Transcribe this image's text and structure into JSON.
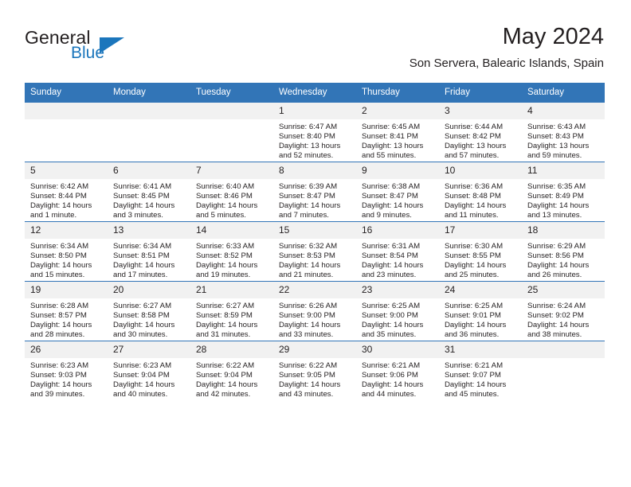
{
  "brand": {
    "name_primary": "General",
    "name_secondary": "Blue",
    "triangle_color": "#1b76bc"
  },
  "header": {
    "month_title": "May 2024",
    "location": "Son Servera, Balearic Islands, Spain"
  },
  "theme": {
    "header_blue": "#3275b7",
    "daynum_gray": "#f1f1f1",
    "text_color": "#231f20"
  },
  "calendar": {
    "weekday_headers": [
      "Sunday",
      "Monday",
      "Tuesday",
      "Wednesday",
      "Thursday",
      "Friday",
      "Saturday"
    ],
    "weeks": [
      [
        {
          "day": "",
          "empty": true
        },
        {
          "day": "",
          "empty": true
        },
        {
          "day": "",
          "empty": true
        },
        {
          "day": "1",
          "sunrise": "Sunrise: 6:47 AM",
          "sunset": "Sunset: 8:40 PM",
          "daylight_line1": "Daylight: 13 hours",
          "daylight_line2": "and 52 minutes."
        },
        {
          "day": "2",
          "sunrise": "Sunrise: 6:45 AM",
          "sunset": "Sunset: 8:41 PM",
          "daylight_line1": "Daylight: 13 hours",
          "daylight_line2": "and 55 minutes."
        },
        {
          "day": "3",
          "sunrise": "Sunrise: 6:44 AM",
          "sunset": "Sunset: 8:42 PM",
          "daylight_line1": "Daylight: 13 hours",
          "daylight_line2": "and 57 minutes."
        },
        {
          "day": "4",
          "sunrise": "Sunrise: 6:43 AM",
          "sunset": "Sunset: 8:43 PM",
          "daylight_line1": "Daylight: 13 hours",
          "daylight_line2": "and 59 minutes."
        }
      ],
      [
        {
          "day": "5",
          "sunrise": "Sunrise: 6:42 AM",
          "sunset": "Sunset: 8:44 PM",
          "daylight_line1": "Daylight: 14 hours",
          "daylight_line2": "and 1 minute."
        },
        {
          "day": "6",
          "sunrise": "Sunrise: 6:41 AM",
          "sunset": "Sunset: 8:45 PM",
          "daylight_line1": "Daylight: 14 hours",
          "daylight_line2": "and 3 minutes."
        },
        {
          "day": "7",
          "sunrise": "Sunrise: 6:40 AM",
          "sunset": "Sunset: 8:46 PM",
          "daylight_line1": "Daylight: 14 hours",
          "daylight_line2": "and 5 minutes."
        },
        {
          "day": "8",
          "sunrise": "Sunrise: 6:39 AM",
          "sunset": "Sunset: 8:47 PM",
          "daylight_line1": "Daylight: 14 hours",
          "daylight_line2": "and 7 minutes."
        },
        {
          "day": "9",
          "sunrise": "Sunrise: 6:38 AM",
          "sunset": "Sunset: 8:47 PM",
          "daylight_line1": "Daylight: 14 hours",
          "daylight_line2": "and 9 minutes."
        },
        {
          "day": "10",
          "sunrise": "Sunrise: 6:36 AM",
          "sunset": "Sunset: 8:48 PM",
          "daylight_line1": "Daylight: 14 hours",
          "daylight_line2": "and 11 minutes."
        },
        {
          "day": "11",
          "sunrise": "Sunrise: 6:35 AM",
          "sunset": "Sunset: 8:49 PM",
          "daylight_line1": "Daylight: 14 hours",
          "daylight_line2": "and 13 minutes."
        }
      ],
      [
        {
          "day": "12",
          "sunrise": "Sunrise: 6:34 AM",
          "sunset": "Sunset: 8:50 PM",
          "daylight_line1": "Daylight: 14 hours",
          "daylight_line2": "and 15 minutes."
        },
        {
          "day": "13",
          "sunrise": "Sunrise: 6:34 AM",
          "sunset": "Sunset: 8:51 PM",
          "daylight_line1": "Daylight: 14 hours",
          "daylight_line2": "and 17 minutes."
        },
        {
          "day": "14",
          "sunrise": "Sunrise: 6:33 AM",
          "sunset": "Sunset: 8:52 PM",
          "daylight_line1": "Daylight: 14 hours",
          "daylight_line2": "and 19 minutes."
        },
        {
          "day": "15",
          "sunrise": "Sunrise: 6:32 AM",
          "sunset": "Sunset: 8:53 PM",
          "daylight_line1": "Daylight: 14 hours",
          "daylight_line2": "and 21 minutes."
        },
        {
          "day": "16",
          "sunrise": "Sunrise: 6:31 AM",
          "sunset": "Sunset: 8:54 PM",
          "daylight_line1": "Daylight: 14 hours",
          "daylight_line2": "and 23 minutes."
        },
        {
          "day": "17",
          "sunrise": "Sunrise: 6:30 AM",
          "sunset": "Sunset: 8:55 PM",
          "daylight_line1": "Daylight: 14 hours",
          "daylight_line2": "and 25 minutes."
        },
        {
          "day": "18",
          "sunrise": "Sunrise: 6:29 AM",
          "sunset": "Sunset: 8:56 PM",
          "daylight_line1": "Daylight: 14 hours",
          "daylight_line2": "and 26 minutes."
        }
      ],
      [
        {
          "day": "19",
          "sunrise": "Sunrise: 6:28 AM",
          "sunset": "Sunset: 8:57 PM",
          "daylight_line1": "Daylight: 14 hours",
          "daylight_line2": "and 28 minutes."
        },
        {
          "day": "20",
          "sunrise": "Sunrise: 6:27 AM",
          "sunset": "Sunset: 8:58 PM",
          "daylight_line1": "Daylight: 14 hours",
          "daylight_line2": "and 30 minutes."
        },
        {
          "day": "21",
          "sunrise": "Sunrise: 6:27 AM",
          "sunset": "Sunset: 8:59 PM",
          "daylight_line1": "Daylight: 14 hours",
          "daylight_line2": "and 31 minutes."
        },
        {
          "day": "22",
          "sunrise": "Sunrise: 6:26 AM",
          "sunset": "Sunset: 9:00 PM",
          "daylight_line1": "Daylight: 14 hours",
          "daylight_line2": "and 33 minutes."
        },
        {
          "day": "23",
          "sunrise": "Sunrise: 6:25 AM",
          "sunset": "Sunset: 9:00 PM",
          "daylight_line1": "Daylight: 14 hours",
          "daylight_line2": "and 35 minutes."
        },
        {
          "day": "24",
          "sunrise": "Sunrise: 6:25 AM",
          "sunset": "Sunset: 9:01 PM",
          "daylight_line1": "Daylight: 14 hours",
          "daylight_line2": "and 36 minutes."
        },
        {
          "day": "25",
          "sunrise": "Sunrise: 6:24 AM",
          "sunset": "Sunset: 9:02 PM",
          "daylight_line1": "Daylight: 14 hours",
          "daylight_line2": "and 38 minutes."
        }
      ],
      [
        {
          "day": "26",
          "sunrise": "Sunrise: 6:23 AM",
          "sunset": "Sunset: 9:03 PM",
          "daylight_line1": "Daylight: 14 hours",
          "daylight_line2": "and 39 minutes."
        },
        {
          "day": "27",
          "sunrise": "Sunrise: 6:23 AM",
          "sunset": "Sunset: 9:04 PM",
          "daylight_line1": "Daylight: 14 hours",
          "daylight_line2": "and 40 minutes."
        },
        {
          "day": "28",
          "sunrise": "Sunrise: 6:22 AM",
          "sunset": "Sunset: 9:04 PM",
          "daylight_line1": "Daylight: 14 hours",
          "daylight_line2": "and 42 minutes."
        },
        {
          "day": "29",
          "sunrise": "Sunrise: 6:22 AM",
          "sunset": "Sunset: 9:05 PM",
          "daylight_line1": "Daylight: 14 hours",
          "daylight_line2": "and 43 minutes."
        },
        {
          "day": "30",
          "sunrise": "Sunrise: 6:21 AM",
          "sunset": "Sunset: 9:06 PM",
          "daylight_line1": "Daylight: 14 hours",
          "daylight_line2": "and 44 minutes."
        },
        {
          "day": "31",
          "sunrise": "Sunrise: 6:21 AM",
          "sunset": "Sunset: 9:07 PM",
          "daylight_line1": "Daylight: 14 hours",
          "daylight_line2": "and 45 minutes."
        },
        {
          "day": "",
          "empty": true
        }
      ]
    ]
  }
}
